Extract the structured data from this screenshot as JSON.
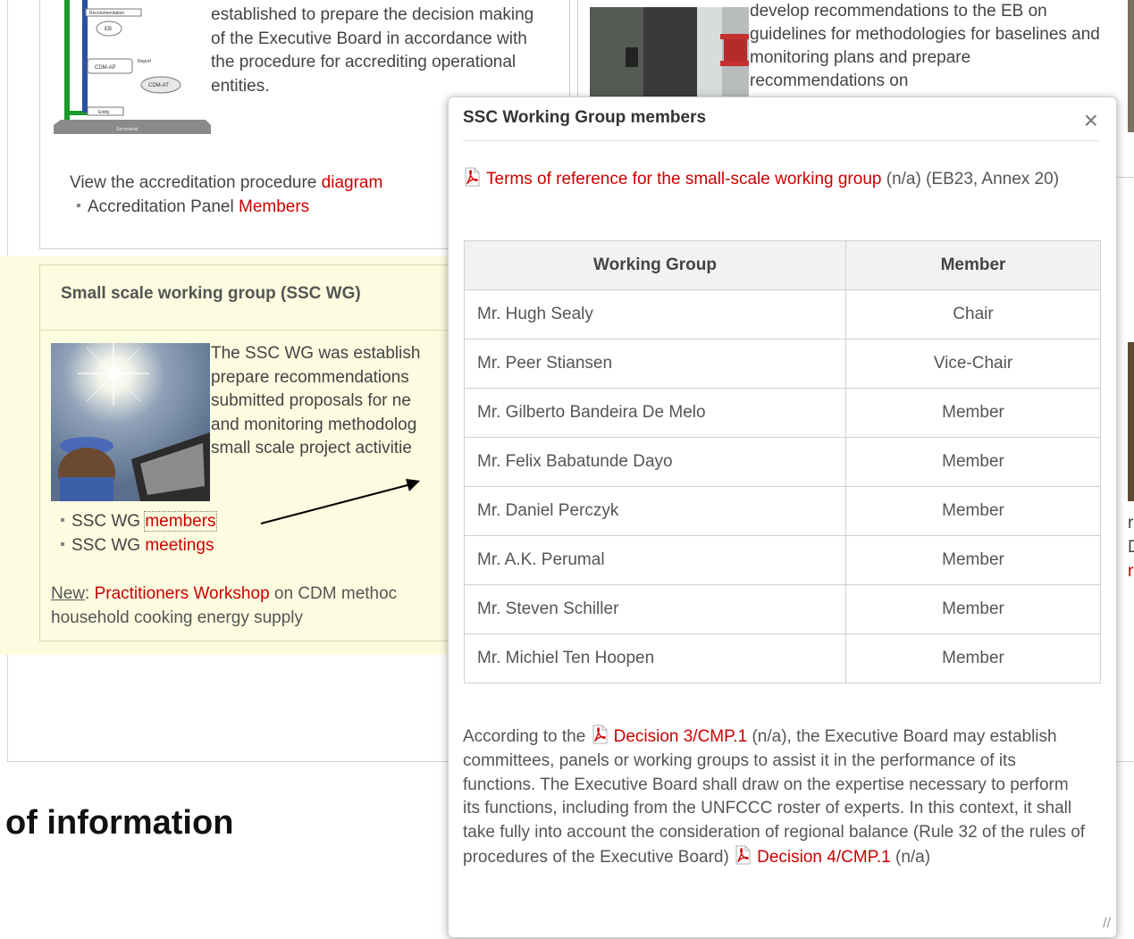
{
  "accreditation": {
    "text": "established to prepare the decision making of the Executive Board in accordance with the procedure for accrediting operational entities.",
    "view_text": "View the accreditation procedure ",
    "view_link": "diagram",
    "panel_text": "Accreditation Panel ",
    "panel_link": "Members",
    "diagram_labels": [
      "Recommendation",
      "EB",
      "CDM-AP",
      "Report",
      "Entity",
      "CDM-AT",
      "Secretariat"
    ]
  },
  "methodologies": {
    "text": "develop recommendations to the EB on guidelines for methodologies for baselines and monitoring plans and prepare recommendations on"
  },
  "ssc_wg": {
    "title": "Small scale working group (SSC WG)",
    "text_lines": [
      "The SSC WG was establish",
      "prepare recommendations",
      "submitted proposals for ne",
      "and monitoring methodolog",
      "small scale project activitie"
    ],
    "link1_prefix": "SSC WG ",
    "link1": "members",
    "link2_prefix": "SSC WG ",
    "link2": "meetings",
    "new_label": "New",
    "new_colon": ": ",
    "new_link": "Practitioners Workshop",
    "new_rest": " on CDM methoc",
    "new_line2": "household cooking energy supply"
  },
  "heading_info": "of information",
  "right_fragment": [
    "r",
    "D",
    "r"
  ],
  "popup": {
    "title": "SSC Working Group members",
    "close": "×",
    "tor_link": "Terms of reference for the small-scale working group",
    "tor_rest": " (n/a) (EB23, Annex 20)",
    "table": {
      "headers": [
        "Working Group",
        "Member"
      ],
      "rows": [
        [
          "Mr. Hugh Sealy",
          "Chair"
        ],
        [
          "Mr. Peer Stiansen",
          "Vice-Chair"
        ],
        [
          "Mr. Gilberto Bandeira De Melo",
          "Member"
        ],
        [
          "Mr. Felix Babatunde Dayo",
          "Member"
        ],
        [
          "Mr. Daniel Perczyk",
          "Member"
        ],
        [
          "Mr. A.K. Perumal",
          "Member"
        ],
        [
          "Mr. Steven Schiller",
          "Member"
        ],
        [
          "Mr. Michiel Ten Hoopen",
          "Member"
        ]
      ]
    },
    "decision_prefix": "According to the ",
    "decision1_link": "Decision 3/CMP.1",
    "decision_body": " (n/a), the Executive Board may establish committees, panels or working groups to assist it in the performance of its functions. The Executive Board shall draw on the expertise necessary to perform its functions, including from the UNFCCC roster of experts. In this context, it shall take fully into account the consideration of regional balance (Rule 32 of the rules of procedures of the Executive Board) ",
    "decision2_link": "Decision 4/CMP.1",
    "decision_suffix": " (n/a)",
    "resize_grip": "//"
  },
  "colors": {
    "link_red": "#cc0000",
    "ssc_background": "#fcfce0",
    "table_header_bg": "#f2f2f2",
    "icon_pdf": "pdf-icon"
  }
}
